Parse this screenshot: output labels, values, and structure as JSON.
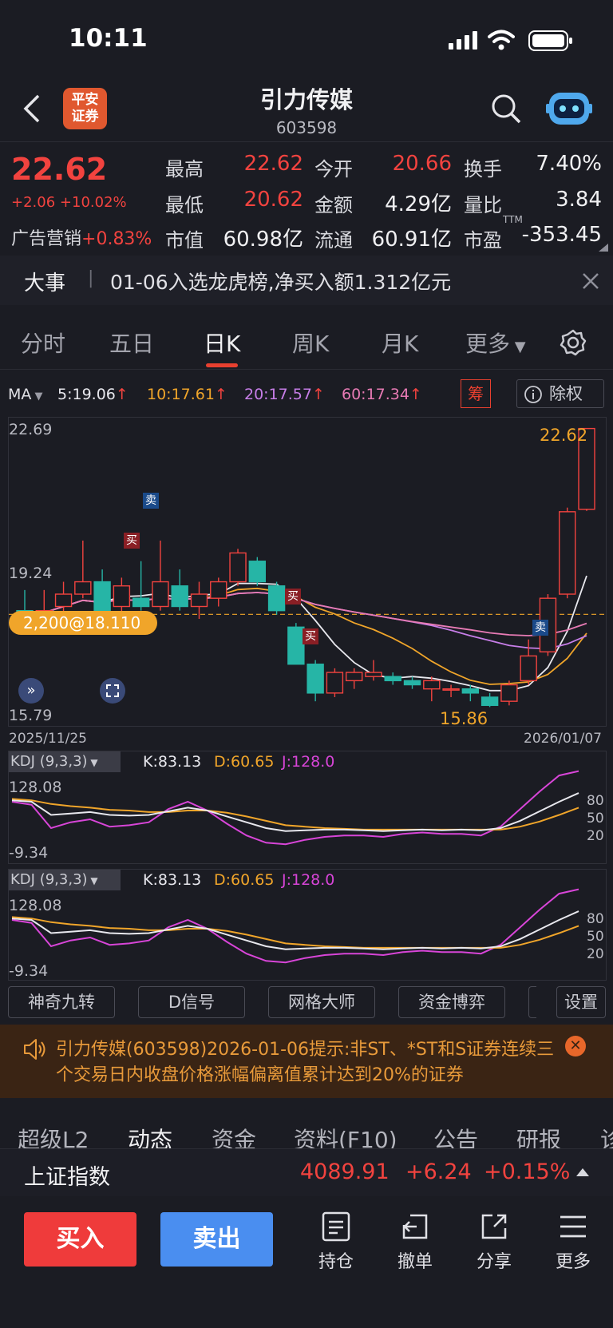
{
  "status_bar": {
    "time": "10:11"
  },
  "header": {
    "broker_logo": "平安\n证券",
    "title": "引力传媒",
    "code": "603598"
  },
  "quote": {
    "price": "22.62",
    "change": "+2.06",
    "change_pct": "+10.02%",
    "sector": {
      "name": "广告营销",
      "change": "+0.83%"
    },
    "fields": [
      {
        "label": "最高",
        "value": "22.62"
      },
      {
        "label": "今开",
        "value": "20.66"
      },
      {
        "label": "换手",
        "value": "7.40%"
      },
      {
        "label": "最低",
        "value": "20.62"
      },
      {
        "label": "金额",
        "value": "4.29亿"
      },
      {
        "label": "量比",
        "value": "3.84"
      },
      {
        "label": "市值",
        "value": "60.98亿"
      },
      {
        "label": "流通",
        "value": "60.91亿"
      },
      {
        "label": "市盈",
        "value": "-353.45",
        "superscript": "TTM"
      }
    ]
  },
  "news": {
    "tag": "大事",
    "separator": "|",
    "text": "01-06入选龙虎榜,净买入额1.312亿元"
  },
  "chart_tabs": [
    "分时",
    "五日",
    "日K",
    "周K",
    "月K",
    "更多"
  ],
  "ma": {
    "label": "MA",
    "items": [
      {
        "text": "5:19.06",
        "color": "#e8e8ee"
      },
      {
        "text": "10:17.61",
        "color": "#f0a52a"
      },
      {
        "text": "20:17.57",
        "color": "#c77ee8"
      },
      {
        "text": "60:17.34",
        "color": "#e87bb5"
      }
    ],
    "chip_label": "筹",
    "exright_label": "除权"
  },
  "kline": {
    "y_high": "22.69",
    "y_mid": "19.24",
    "y_low": "15.79",
    "last_label": "22.62",
    "low_label": "15.86",
    "cost_badge": "2,200@18.110",
    "date_start": "2025/11/25",
    "date_end": "2026/01/07",
    "signal_buy": "买",
    "signal_sell": "卖"
  },
  "chart_data": {
    "type": "candlestick",
    "dates": [
      "2025/11/25",
      "2026/01/07"
    ],
    "ylim": [
      15.79,
      22.69
    ],
    "candles": [
      {
        "o": 18.2,
        "h": 18.7,
        "l": 17.9,
        "c": 18.1
      },
      {
        "o": 18.1,
        "h": 18.7,
        "l": 17.9,
        "c": 18.2
      },
      {
        "o": 18.3,
        "h": 18.9,
        "l": 18.0,
        "c": 18.6
      },
      {
        "o": 18.6,
        "h": 19.9,
        "l": 18.5,
        "c": 18.9
      },
      {
        "o": 18.9,
        "h": 19.2,
        "l": 18.0,
        "c": 18.2
      },
      {
        "o": 18.3,
        "h": 19.0,
        "l": 18.1,
        "c": 18.8
      },
      {
        "o": 18.5,
        "h": 19.4,
        "l": 18.2,
        "c": 18.3
      },
      {
        "o": 18.3,
        "h": 19.9,
        "l": 18.2,
        "c": 18.9
      },
      {
        "o": 18.8,
        "h": 19.2,
        "l": 18.2,
        "c": 18.3
      },
      {
        "o": 18.3,
        "h": 18.9,
        "l": 18.0,
        "c": 18.6
      },
      {
        "o": 18.5,
        "h": 19.0,
        "l": 18.3,
        "c": 18.9
      },
      {
        "o": 18.9,
        "h": 19.7,
        "l": 18.8,
        "c": 19.6
      },
      {
        "o": 19.4,
        "h": 19.5,
        "l": 18.8,
        "c": 18.9
      },
      {
        "o": 18.8,
        "h": 18.9,
        "l": 18.1,
        "c": 18.2
      },
      {
        "o": 17.8,
        "h": 17.9,
        "l": 16.9,
        "c": 16.9
      },
      {
        "o": 16.9,
        "h": 17.0,
        "l": 16.0,
        "c": 16.2
      },
      {
        "o": 16.2,
        "h": 16.8,
        "l": 16.1,
        "c": 16.7
      },
      {
        "o": 16.5,
        "h": 16.8,
        "l": 16.3,
        "c": 16.7
      },
      {
        "o": 16.6,
        "h": 17.0,
        "l": 16.5,
        "c": 16.7
      },
      {
        "o": 16.6,
        "h": 16.7,
        "l": 16.4,
        "c": 16.5
      },
      {
        "o": 16.5,
        "h": 16.6,
        "l": 16.3,
        "c": 16.4
      },
      {
        "o": 16.3,
        "h": 16.6,
        "l": 16.0,
        "c": 16.5
      },
      {
        "o": 16.3,
        "h": 16.4,
        "l": 16.1,
        "c": 16.3
      },
      {
        "o": 16.3,
        "h": 16.4,
        "l": 16.0,
        "c": 16.2
      },
      {
        "o": 16.1,
        "h": 16.2,
        "l": 15.86,
        "c": 15.9
      },
      {
        "o": 16.0,
        "h": 16.5,
        "l": 15.9,
        "c": 16.4
      },
      {
        "o": 16.5,
        "h": 17.5,
        "l": 16.4,
        "c": 17.1
      },
      {
        "o": 17.2,
        "h": 18.6,
        "l": 17.1,
        "c": 18.5
      },
      {
        "o": 18.6,
        "h": 20.7,
        "l": 18.5,
        "c": 20.6
      },
      {
        "o": 20.66,
        "h": 22.62,
        "l": 20.62,
        "c": 22.62
      }
    ]
  },
  "kdj_panels": [
    {
      "name": "KDJ (9,3,3)",
      "k": "K:83.13",
      "d": "D:60.65",
      "j": "J:128.0",
      "y_max": "128.08",
      "y_min": "-9.34",
      "levels": [
        "80",
        "50",
        "20"
      ]
    },
    {
      "name": "KDJ (9,3,3)",
      "k": "K:83.13",
      "d": "D:60.65",
      "j": "J:128.0",
      "y_max": "128.08",
      "y_min": "-9.34",
      "levels": [
        "80",
        "50",
        "20"
      ]
    }
  ],
  "tool_buttons": [
    "神奇九转",
    "D信号",
    "网格大师",
    "资金博弈"
  ],
  "settings_label": "设置",
  "notice": {
    "text": "引力传媒(603598)2026-01-06提示:非ST、*ST和S证券连续三个交易日内收盘价格涨幅偏离值累计达到20%的证券"
  },
  "bottom_tabs": [
    "超级L2",
    "动态",
    "资金",
    "资料(F10)",
    "公告",
    "研报",
    "诊"
  ],
  "index": {
    "name": "上证指数",
    "value": "4089.91",
    "change": "+6.24",
    "change_pct": "+0.15%"
  },
  "actions": {
    "buy": "买入",
    "sell": "卖出",
    "tools": [
      "持仓",
      "撤单",
      "分享",
      "更多"
    ]
  },
  "colors": {
    "up": "#f2433f",
    "down": "#26b5a6",
    "accent": "#e8402f",
    "sell_btn": "#4a8ef0",
    "bg": "#1b1c23"
  }
}
